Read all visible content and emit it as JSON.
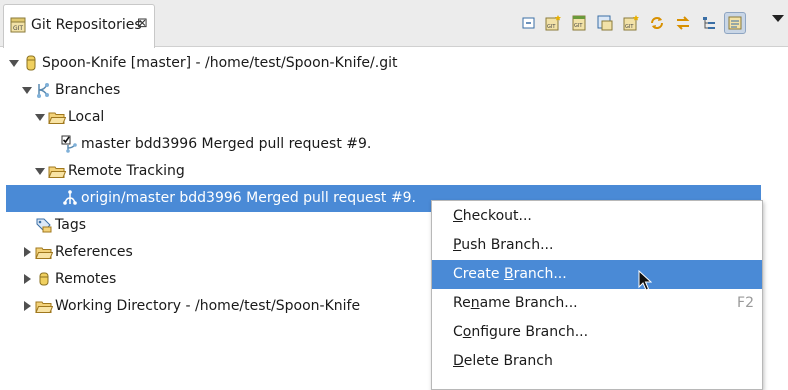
{
  "view": {
    "title": "Git Repositories",
    "close_glyph": "⊠",
    "toolbar_icons": [
      "collapse-all-icon",
      "add-repository-icon",
      "clone-repository-icon",
      "create-repository-icon",
      "import-projects-icon",
      "refresh-icon",
      "link-with-selection-icon",
      "hierarchical-layout-icon",
      "show-details-icon"
    ],
    "accent_color": "#4a8ad6"
  },
  "tree": {
    "repository": "Spoon-Knife [master] - /home/test/Spoon-Knife/.git",
    "branches": "Branches",
    "local": "Local",
    "local_master": "master bdd3996 Merged pull request #9.",
    "remote_tracking": "Remote Tracking",
    "origin_master": "origin/master bdd3996 Merged pull request #9.",
    "tags": "Tags",
    "references": "References",
    "remotes": "Remotes",
    "working_directory": "Working Directory - /home/test/Spoon-Knife"
  },
  "context_menu": {
    "checkout": {
      "pre": "",
      "mnemonic": "C",
      "post": "heckout..."
    },
    "push_branch": {
      "pre": "",
      "mnemonic": "P",
      "post": "ush Branch..."
    },
    "create_branch": {
      "pre": "Create ",
      "mnemonic": "B",
      "post": "ranch..."
    },
    "rename_branch": {
      "pre": "Re",
      "mnemonic": "n",
      "post": "ame Branch...",
      "shortcut": "F2"
    },
    "configure_branch": {
      "pre": "C",
      "mnemonic": "o",
      "post": "nfigure Branch..."
    },
    "delete_branch": {
      "pre": "",
      "mnemonic": "D",
      "post": "elete Branch"
    }
  }
}
